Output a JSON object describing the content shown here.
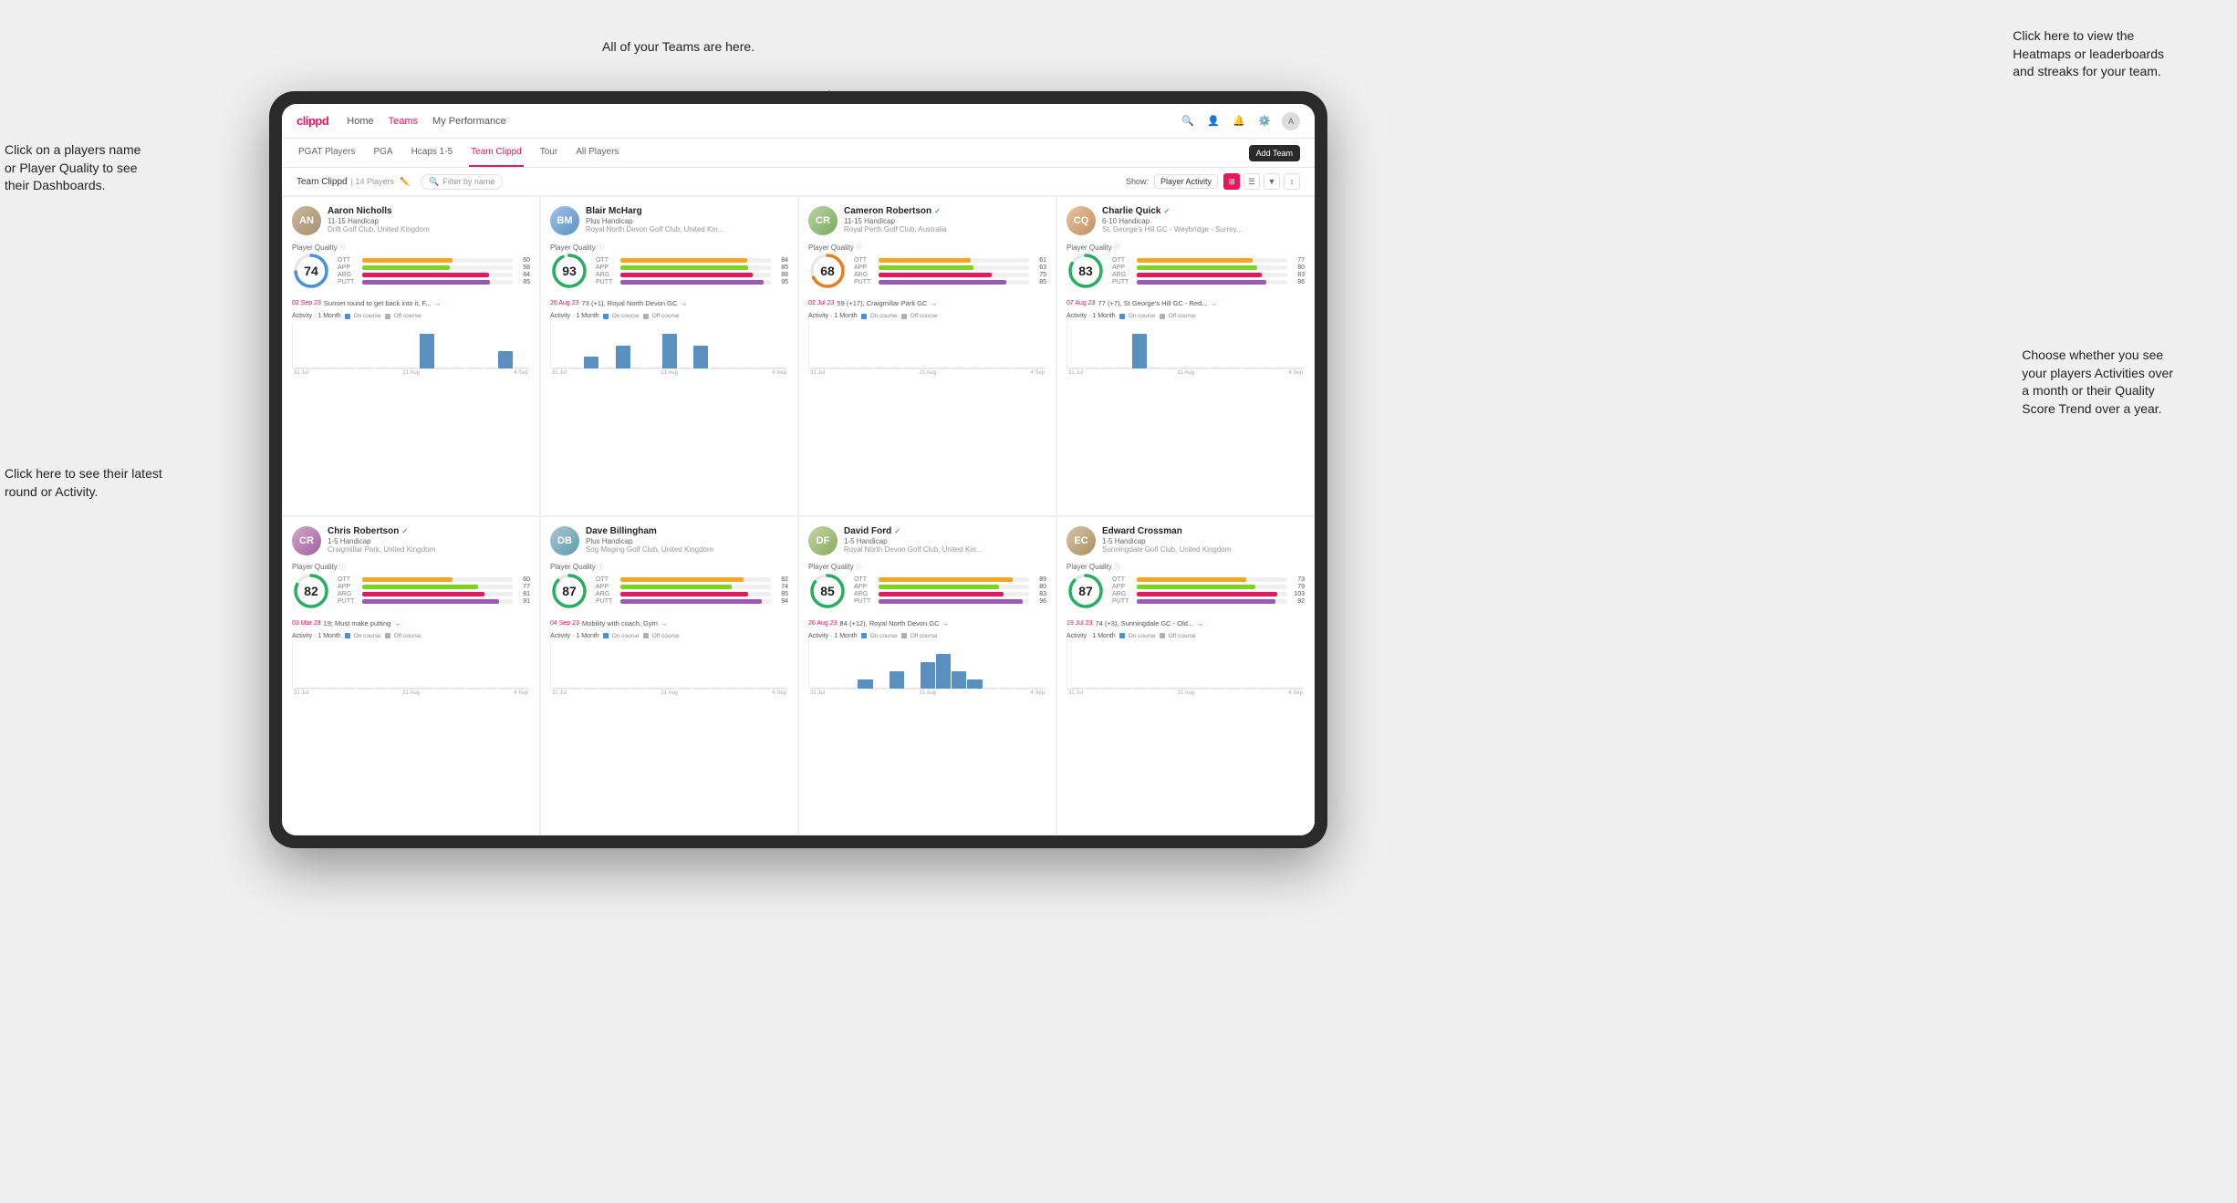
{
  "annotations": {
    "teams_text": "All of your Teams are here.",
    "heatmaps_text": "Click here to view the\nHeatmaps or leaderboards\nand streaks for your team.",
    "players_name_text": "Click on a players name\nor Player Quality to see\ntheir Dashboards.",
    "latest_round_text": "Click here to see their latest\nround or Activity.",
    "activities_text": "Choose whether you see\nyour players Activities over\na month or their Quality\nScore Trend over a year."
  },
  "nav": {
    "logo": "clippd",
    "links": [
      "Home",
      "Teams",
      "My Performance"
    ],
    "active": "Teams"
  },
  "tabs": {
    "items": [
      "PGAT Players",
      "PGA",
      "Hcaps 1-5",
      "Team Clippd",
      "Tour",
      "All Players"
    ],
    "active": "Team Clippd",
    "add_button": "Add Team"
  },
  "team_header": {
    "title": "Team Clippd",
    "separator": "|",
    "count": "14 Players",
    "search_placeholder": "Filter by name",
    "show_label": "Show:",
    "show_value": "Player Activity"
  },
  "players": [
    {
      "name": "Aaron Nicholls",
      "handicap": "11-15 Handicap",
      "club": "Drift Golf Club, United Kingdom",
      "quality": 74,
      "quality_color": "#4a90d9",
      "stats": [
        {
          "label": "OTT",
          "color": "#f5a623",
          "value": 60,
          "max": 100
        },
        {
          "label": "APP",
          "color": "#7ed321",
          "value": 58,
          "max": 100
        },
        {
          "label": "ARG",
          "color": "#e8175d",
          "value": 84,
          "max": 100
        },
        {
          "label": "PUTT",
          "color": "#9b59b6",
          "value": 85,
          "max": 100
        }
      ],
      "latest_date": "02 Sep 23",
      "latest_text": "Sunset round to get back into it, F...",
      "chart_bars": [
        0,
        0,
        0,
        0,
        0,
        0,
        0,
        0,
        2,
        0,
        0,
        0,
        0,
        1,
        0
      ],
      "chart_dates": [
        "31 Jul",
        "21 Aug",
        "4 Sep"
      ]
    },
    {
      "name": "Blair McHarg",
      "handicap": "Plus Handicap",
      "club": "Royal North Devon Golf Club, United Kin...",
      "quality": 93,
      "quality_color": "#27ae60",
      "stats": [
        {
          "label": "OTT",
          "color": "#f5a623",
          "value": 84,
          "max": 100
        },
        {
          "label": "APP",
          "color": "#7ed321",
          "value": 85,
          "max": 100
        },
        {
          "label": "ARG",
          "color": "#e8175d",
          "value": 88,
          "max": 100
        },
        {
          "label": "PUTT",
          "color": "#9b59b6",
          "value": 95,
          "max": 100
        }
      ],
      "latest_date": "26 Aug 23",
      "latest_text": "73 (+1), Royal North Devon GC",
      "chart_bars": [
        0,
        0,
        1,
        0,
        2,
        0,
        0,
        3,
        0,
        2,
        0,
        0,
        0,
        0,
        0
      ],
      "chart_dates": [
        "31 Jul",
        "21 Aug",
        "4 Sep"
      ]
    },
    {
      "name": "Cameron Robertson",
      "handicap": "11-15 Handicap",
      "club": "Royal Perth Golf Club, Australia",
      "quality": 68,
      "quality_color": "#e67e22",
      "verified": true,
      "stats": [
        {
          "label": "OTT",
          "color": "#f5a623",
          "value": 61,
          "max": 100
        },
        {
          "label": "APP",
          "color": "#7ed321",
          "value": 63,
          "max": 100
        },
        {
          "label": "ARG",
          "color": "#e8175d",
          "value": 75,
          "max": 100
        },
        {
          "label": "PUTT",
          "color": "#9b59b6",
          "value": 85,
          "max": 100
        }
      ],
      "latest_date": "02 Jul 23",
      "latest_text": "59 (+17), Craigmillar Park GC",
      "chart_bars": [
        0,
        0,
        0,
        0,
        0,
        0,
        0,
        0,
        0,
        0,
        0,
        0,
        0,
        0,
        0
      ],
      "chart_dates": [
        "31 Jul",
        "21 Aug",
        "4 Sep"
      ]
    },
    {
      "name": "Charlie Quick",
      "handicap": "6-10 Handicap",
      "club": "St. George's Hill GC - Weybridge - Surrey...",
      "quality": 83,
      "quality_color": "#27ae60",
      "verified": true,
      "stats": [
        {
          "label": "OTT",
          "color": "#f5a623",
          "value": 77,
          "max": 100
        },
        {
          "label": "APP",
          "color": "#7ed321",
          "value": 80,
          "max": 100
        },
        {
          "label": "ARG",
          "color": "#e8175d",
          "value": 83,
          "max": 100
        },
        {
          "label": "PUTT",
          "color": "#9b59b6",
          "value": 86,
          "max": 100
        }
      ],
      "latest_date": "07 Aug 23",
      "latest_text": "77 (+7), St George's Hill GC - Red...",
      "chart_bars": [
        0,
        0,
        0,
        0,
        1,
        0,
        0,
        0,
        0,
        0,
        0,
        0,
        0,
        0,
        0
      ],
      "chart_dates": [
        "31 Jul",
        "21 Aug",
        "4 Sep"
      ]
    },
    {
      "name": "Chris Robertson",
      "handicap": "1-5 Handicap",
      "club": "Craigmillar Park, United Kingdom",
      "quality": 82,
      "quality_color": "#27ae60",
      "verified": true,
      "stats": [
        {
          "label": "OTT",
          "color": "#f5a623",
          "value": 60,
          "max": 100
        },
        {
          "label": "APP",
          "color": "#7ed321",
          "value": 77,
          "max": 100
        },
        {
          "label": "ARG",
          "color": "#e8175d",
          "value": 81,
          "max": 100
        },
        {
          "label": "PUTT",
          "color": "#9b59b6",
          "value": 91,
          "max": 100
        }
      ],
      "latest_date": "03 Mar 23",
      "latest_text": "19; Must make putting",
      "chart_bars": [
        0,
        0,
        0,
        0,
        0,
        0,
        0,
        0,
        0,
        0,
        0,
        0,
        0,
        0,
        0
      ],
      "chart_dates": [
        "31 Jul",
        "21 Aug",
        "4 Sep"
      ]
    },
    {
      "name": "Dave Billingham",
      "handicap": "Plus Handicap",
      "club": "Sog Maging Golf Club, United Kingdom",
      "quality": 87,
      "quality_color": "#27ae60",
      "stats": [
        {
          "label": "OTT",
          "color": "#f5a623",
          "value": 82,
          "max": 100
        },
        {
          "label": "APP",
          "color": "#7ed321",
          "value": 74,
          "max": 100
        },
        {
          "label": "ARG",
          "color": "#e8175d",
          "value": 85,
          "max": 100
        },
        {
          "label": "PUTT",
          "color": "#9b59b6",
          "value": 94,
          "max": 100
        }
      ],
      "latest_date": "04 Sep 23",
      "latest_text": "Mobility with coach, Gym",
      "chart_bars": [
        0,
        0,
        0,
        0,
        0,
        0,
        0,
        0,
        0,
        0,
        0,
        0,
        0,
        0,
        0
      ],
      "chart_dates": [
        "31 Jul",
        "21 Aug",
        "4 Sep"
      ]
    },
    {
      "name": "David Ford",
      "handicap": "1-5 Handicap",
      "club": "Royal North Devon Golf Club, United Kin...",
      "quality": 85,
      "quality_color": "#27ae60",
      "verified": true,
      "stats": [
        {
          "label": "OTT",
          "color": "#f5a623",
          "value": 89,
          "max": 100
        },
        {
          "label": "APP",
          "color": "#7ed321",
          "value": 80,
          "max": 100
        },
        {
          "label": "ARG",
          "color": "#e8175d",
          "value": 83,
          "max": 100
        },
        {
          "label": "PUTT",
          "color": "#9b59b6",
          "value": 96,
          "max": 100
        }
      ],
      "latest_date": "26 Aug 23",
      "latest_text": "84 (+12), Royal North Devon GC",
      "chart_bars": [
        0,
        0,
        0,
        1,
        0,
        2,
        0,
        3,
        4,
        2,
        1,
        0,
        0,
        0,
        0
      ],
      "chart_dates": [
        "31 Jul",
        "21 Aug",
        "4 Sep"
      ]
    },
    {
      "name": "Edward Crossman",
      "handicap": "1-5 Handicap",
      "club": "Sunningdale Golf Club, United Kingdom",
      "quality": 87,
      "quality_color": "#27ae60",
      "stats": [
        {
          "label": "OTT",
          "color": "#f5a623",
          "value": 73,
          "max": 100
        },
        {
          "label": "APP",
          "color": "#7ed321",
          "value": 79,
          "max": 100
        },
        {
          "label": "ARG",
          "color": "#e8175d",
          "value": 103,
          "max": 110
        },
        {
          "label": "PUTT",
          "color": "#9b59b6",
          "value": 92,
          "max": 100
        }
      ],
      "latest_date": "19 Jul 23",
      "latest_text": "74 (+3), Sunningdale GC - Old...",
      "chart_bars": [
        0,
        0,
        0,
        0,
        0,
        0,
        0,
        0,
        0,
        0,
        0,
        0,
        0,
        0,
        0
      ],
      "chart_dates": [
        "31 Jul",
        "21 Aug",
        "4 Sep"
      ]
    }
  ]
}
